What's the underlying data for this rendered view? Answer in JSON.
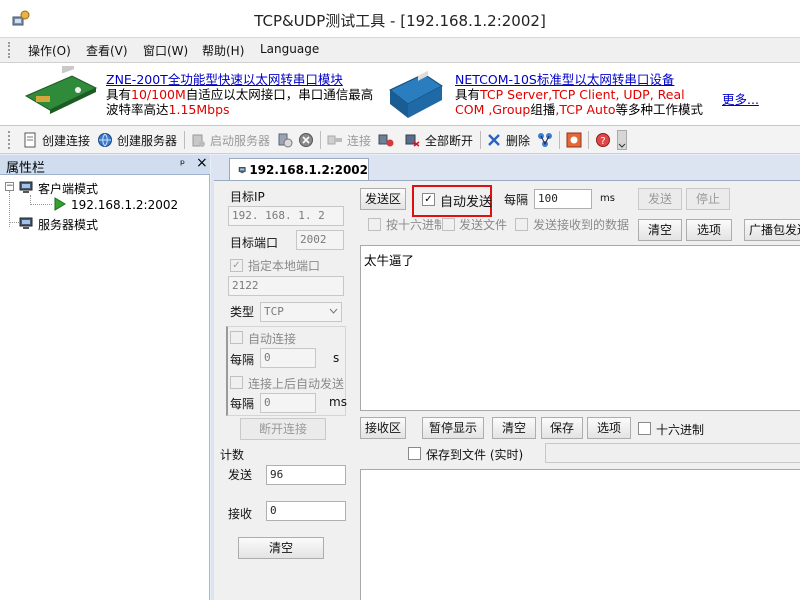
{
  "window": {
    "title": "TCP&UDP测试工具 - [192.168.1.2:2002]"
  },
  "menu": [
    "操作(O)",
    "查看(V)",
    "窗口(W)",
    "帮助(H)",
    "Language"
  ],
  "banner": {
    "ad1": {
      "link": "ZNE-200T全功能型快速以太网转串口模块",
      "line2_a": "具有",
      "line2_red": "10/100M",
      "line2_b": "自适应以太网接口，串口通信最高",
      "line3_a": "波特率高达",
      "line3_red": "1.15Mbps"
    },
    "ad2": {
      "link": "NETCOM-10S标准型以太网转串口设备",
      "line2_a": "具有",
      "line2_red": "TCP Server,TCP Client, UDP, Real",
      "line3_red_a": "COM ,Group",
      "line3_b": "组播",
      "line3_red_b": ",TCP Auto",
      "line3_c": "等多种工作模式"
    },
    "more": "更多..."
  },
  "toolbar": {
    "create_connection": "创建连接",
    "create_server": "创建服务器",
    "start_server": "启动服务器",
    "connect": "连接",
    "disconnect_all": "全部断开",
    "delete": "删除"
  },
  "left_panel": {
    "title": "属性栏",
    "pin": "ᵖ",
    "close": "×",
    "tree": {
      "client_mode": "客户端模式",
      "connection": "192.168.1.2:2002",
      "server_mode": "服务器模式"
    }
  },
  "tab": {
    "label": "192.168.1.2:2002"
  },
  "settings": {
    "target_ip_label": "目标IP",
    "target_ip": "192. 168. 1. 2",
    "target_port_label": "目标端口",
    "target_port": "2002",
    "local_port_check": "指定本地端口",
    "local_port": "2122",
    "type_label": "类型",
    "type_value": "TCP",
    "auto_connect": "自动连接",
    "interval_label": "每隔",
    "interval_1": "0",
    "unit_s": "s",
    "auto_send_after": "连接上后自动发送",
    "interval_2": "0",
    "unit_ms": "ms",
    "disconnect_btn": "断开连接",
    "count_label": "计数",
    "send_label": "发送",
    "send_count": "96",
    "recv_label": "接收",
    "recv_count": "0",
    "clear_btn": "清空"
  },
  "send_panel": {
    "send_area": "发送区",
    "auto_send": "自动发送",
    "interval_label": "每隔",
    "interval_value": "100",
    "unit": "ms",
    "send_btn": "发送",
    "stop_btn": "停止",
    "hex_check": "按十六进制",
    "send_file": "发送文件",
    "send_received": "发送接收到的数据",
    "clear_btn": "清空",
    "options_btn": "选项",
    "broadcast_btn": "广播包发送",
    "text": "太牛逼了"
  },
  "recv_panel": {
    "recv_area": "接收区",
    "pause_btn": "暂停显示",
    "clear_btn": "清空",
    "save_btn": "保存",
    "options_btn": "选项",
    "hex_check": "十六进制",
    "save_to_file": "保存到文件 (实时)"
  },
  "colors": {
    "highlight": "#e01010",
    "link": "#0000c8",
    "panel_header": "#cfddef"
  }
}
